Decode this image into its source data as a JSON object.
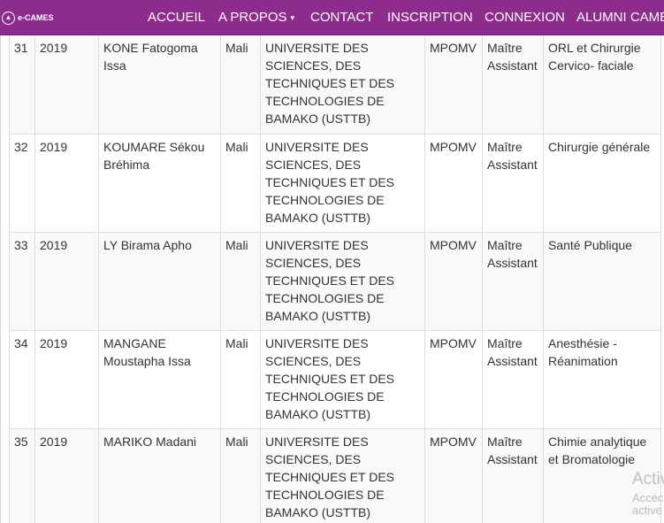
{
  "navbar": {
    "brand": "e-CAMES",
    "items": [
      {
        "label": "ACCUEIL"
      },
      {
        "label": "A PROPOS"
      },
      {
        "label": "CONTACT"
      },
      {
        "label": "INSCRIPTION"
      },
      {
        "label": "CONNEXION"
      },
      {
        "label": "ALUMNI CAME"
      }
    ],
    "dropdown_caret": "▾"
  },
  "table": {
    "rows": [
      {
        "num": "31",
        "year": "2019",
        "name": "KONE Fatogoma Issa",
        "country": "Mali",
        "university": "UNIVERSITE DES SCIENCES, DES TECHNIQUES ET DES TECHNOLOGIES DE BAMAKO (USTTB)",
        "committee": "MPOMV",
        "grade": "Maître Assistant",
        "specialty": "ORL et Chirurgie Cervico- faciale"
      },
      {
        "num": "32",
        "year": "2019",
        "name": "KOUMARE Sékou Bréhima",
        "country": "Mali",
        "university": "UNIVERSITE DES SCIENCES, DES TECHNIQUES ET DES TECHNOLOGIES DE BAMAKO (USTTB)",
        "committee": "MPOMV",
        "grade": "Maître Assistant",
        "specialty": "Chirurgie générale"
      },
      {
        "num": "33",
        "year": "2019",
        "name": "LY Birama Apho",
        "country": "Mali",
        "university": "UNIVERSITE DES SCIENCES, DES TECHNIQUES ET DES TECHNOLOGIES DE BAMAKO (USTTB)",
        "committee": "MPOMV",
        "grade": "Maître Assistant",
        "specialty": "Santé Publique"
      },
      {
        "num": "34",
        "year": "2019",
        "name": "MANGANE Moustapha Issa",
        "country": "Mali",
        "university": "UNIVERSITE DES SCIENCES, DES TECHNIQUES ET DES TECHNOLOGIES DE BAMAKO (USTTB)",
        "committee": "MPOMV",
        "grade": "Maître Assistant",
        "specialty": "Anesthésie - Réanimation"
      },
      {
        "num": "35",
        "year": "2019",
        "name": "MARIKO Madani",
        "country": "Mali",
        "university": "UNIVERSITE DES SCIENCES, DES TECHNIQUES ET DES TECHNOLOGIES DE BAMAKO (USTTB)",
        "committee": "MPOMV",
        "grade": "Maître Assistant",
        "specialty": "Chimie analytique et Bromatologie"
      }
    ]
  },
  "watermark": {
    "line1": "Activ",
    "line2": "Accéc",
    "line3": "active"
  },
  "colors": {
    "navbar": "#8e2c8e",
    "row_striped": "#f9f9f9",
    "border": "#dddddd"
  }
}
